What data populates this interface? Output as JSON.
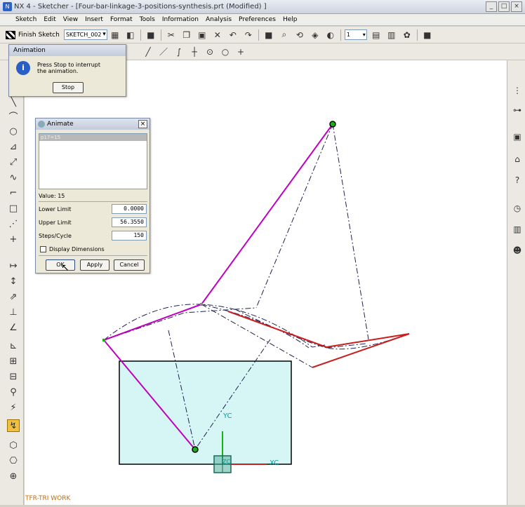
{
  "window": {
    "title": "NX 4 - Sketcher - [Four-bar-linkage-3-positions-synthesis.prt (Modified) ]",
    "min": "_",
    "max": "□",
    "close": "×"
  },
  "menu": [
    "Sketch",
    "Edit",
    "View",
    "Insert",
    "Format",
    "Tools",
    "Information",
    "Analysis",
    "Preferences",
    "Help"
  ],
  "toolbar": {
    "finish_label": "Finish Sketch",
    "sketch_name": "SKETCH_002",
    "layer_value": "1"
  },
  "animation_dialog": {
    "title": "Animation",
    "message_line1": "Press Stop to interrupt",
    "message_line2": "the animation.",
    "stop_label": "Stop"
  },
  "animate_dialog": {
    "title": "Animate",
    "list_item": "p17=15",
    "value_label": "Value:",
    "value": "15",
    "lower_label": "Lower Limit",
    "lower_value": "0.0000",
    "upper_label": "Upper Limit",
    "upper_value": "56.3550",
    "steps_label": "Steps/Cycle",
    "steps_value": "150",
    "display_dims_label": "Display Dimensions",
    "ok_label": "OK",
    "apply_label": "Apply",
    "cancel_label": "Cancel"
  },
  "canvas": {
    "yc_label": "YC",
    "xc_label": "XC",
    "zc_label": "ZC"
  },
  "status": {
    "watermark": "TFR-TRI WORK"
  },
  "colors": {
    "magenta": "#c000c0",
    "red": "#c81e1e",
    "box_fill": "#d6f5f5",
    "green": "#14b414"
  }
}
